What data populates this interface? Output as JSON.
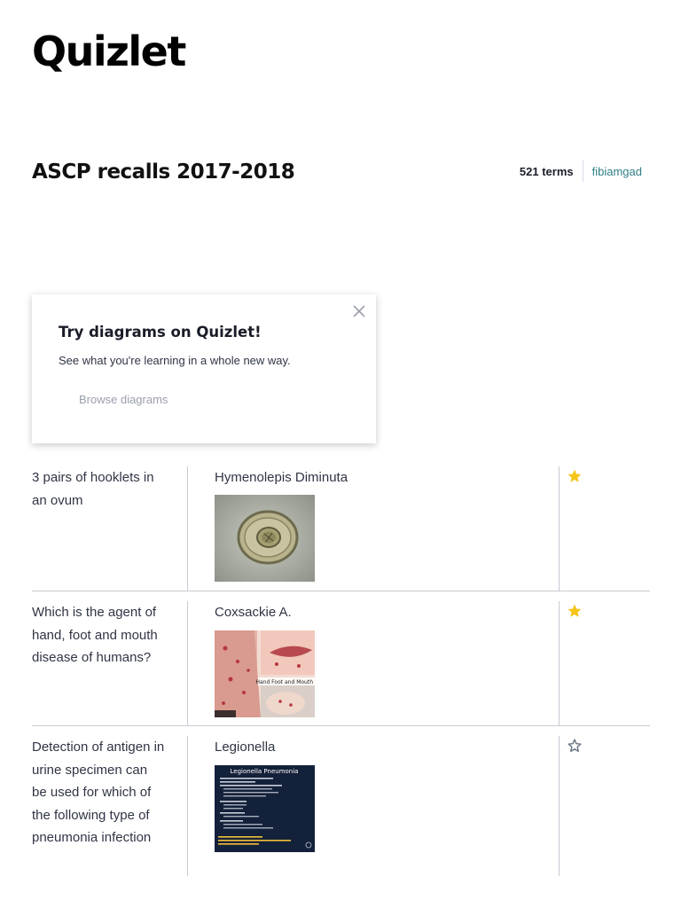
{
  "header": {
    "logo": "Quizlet"
  },
  "set": {
    "title": "ASCP recalls 2017-2018",
    "term_count": "521 terms",
    "author": "fibiamgad"
  },
  "promo": {
    "title": "Try diagrams on Quizlet!",
    "text": "See what you're learning in a whole new way.",
    "link": "Browse diagrams",
    "close_icon": "close-icon"
  },
  "colors": {
    "star_filled": "#F5C518",
    "star_outline": "#646F7F",
    "author_link": "#2F7F86",
    "divider": "#C7CBD3"
  },
  "terms": [
    {
      "term": "3 pairs of hooklets in an ovum",
      "definition": "Hymenolepis Diminuta",
      "starred": true,
      "image": "ovum-micrograph"
    },
    {
      "term": "Which is the agent of hand, foot and mouth disease of humans?",
      "definition": "Coxsackie A.",
      "starred": true,
      "image": "hand-foot-mouth-photo",
      "image_caption": "Hand Foot and Mouth"
    },
    {
      "term": "Detection of antigen in urine specimen can be used for which of the following type of pneumonia infection",
      "definition": "Legionella",
      "starred": false,
      "image": "legionella-slide",
      "image_caption": "Legionella Pneumonia"
    }
  ]
}
